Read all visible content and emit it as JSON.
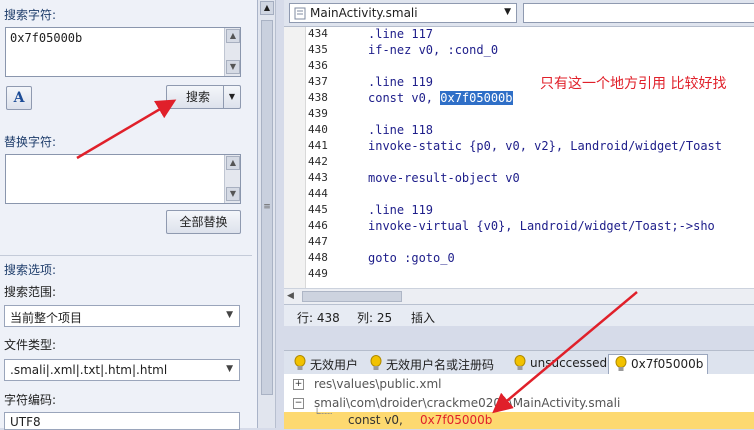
{
  "left": {
    "search_label": "搜索字符:",
    "search_value": "0x7f05000b",
    "font_icon": "A",
    "search_button": "搜索",
    "replace_label": "替换字符:",
    "replace_value": "",
    "replace_all_button": "全部替换",
    "options_label": "搜索选项:",
    "scope_label": "搜索范围:",
    "scope_value": "当前整个项目",
    "filetype_label": "文件类型:",
    "filetype_value": ".smali|.xml|.txt|.htm|.html",
    "encoding_label": "字符编码:",
    "encoding_value": "UTF8"
  },
  "editor": {
    "file_tab": "MainActivity.smali",
    "lines": [
      {
        "n": "434",
        "code": ".line 117"
      },
      {
        "n": "435",
        "code": "if-nez v0, :cond_0"
      },
      {
        "n": "436",
        "code": ""
      },
      {
        "n": "437",
        "code": ".line 119"
      },
      {
        "n": "438",
        "pre": "const v0, ",
        "sel": "0x7f05000b"
      },
      {
        "n": "439",
        "code": ""
      },
      {
        "n": "440",
        "code": ".line 118"
      },
      {
        "n": "441",
        "code": "invoke-static {p0, v0, v2}, Landroid/widget/Toast"
      },
      {
        "n": "442",
        "code": ""
      },
      {
        "n": "443",
        "code": "move-result-object v0"
      },
      {
        "n": "444",
        "code": ""
      },
      {
        "n": "445",
        "code": ".line 119"
      },
      {
        "n": "446",
        "code": "invoke-virtual {v0}, Landroid/widget/Toast;->sho"
      },
      {
        "n": "447",
        "code": ""
      },
      {
        "n": "448",
        "code": "goto :goto_0"
      },
      {
        "n": "449",
        "code": ""
      }
    ],
    "annotation": "只有这一个地方引用 比较好找"
  },
  "status": {
    "row_label": "行: 438",
    "col_label": "列: 25",
    "mode": "插入"
  },
  "bottom_tabs": [
    {
      "label": "无效用户"
    },
    {
      "label": "无效用户名或注册码"
    },
    {
      "label": "unsuccessed"
    },
    {
      "label": "0x7f05000b"
    }
  ],
  "results": {
    "row1": "res\\values\\public.xml",
    "row2": "smali\\com\\droider\\crackme0201\\MainActivity.smali",
    "hit_pre": "const v0, ",
    "hit_value": "0x7f05000b"
  },
  "colors": {
    "annotation": "#e0202a",
    "selection": "#2f6fc7",
    "hit_highlight": "#fdd970",
    "bulb": "#f2c200"
  }
}
